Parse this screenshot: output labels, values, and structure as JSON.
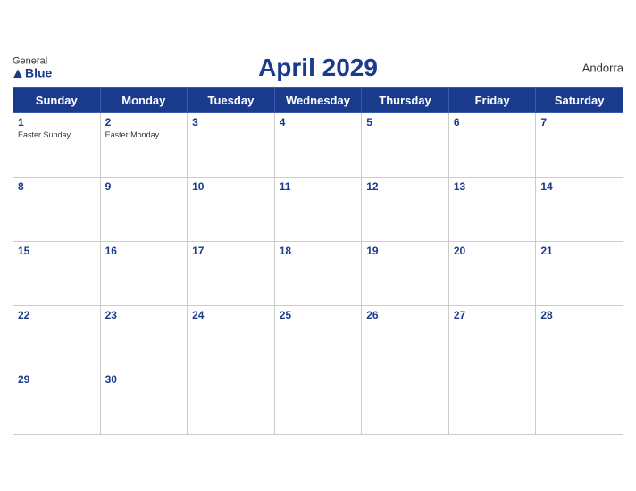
{
  "header": {
    "title": "April 2029",
    "region": "Andorra",
    "logo_general": "General",
    "logo_blue": "Blue"
  },
  "weekdays": [
    "Sunday",
    "Monday",
    "Tuesday",
    "Wednesday",
    "Thursday",
    "Friday",
    "Saturday"
  ],
  "weeks": [
    [
      {
        "day": "1",
        "holiday": "Easter Sunday"
      },
      {
        "day": "2",
        "holiday": "Easter Monday"
      },
      {
        "day": "3",
        "holiday": ""
      },
      {
        "day": "4",
        "holiday": ""
      },
      {
        "day": "5",
        "holiday": ""
      },
      {
        "day": "6",
        "holiday": ""
      },
      {
        "day": "7",
        "holiday": ""
      }
    ],
    [
      {
        "day": "8",
        "holiday": ""
      },
      {
        "day": "9",
        "holiday": ""
      },
      {
        "day": "10",
        "holiday": ""
      },
      {
        "day": "11",
        "holiday": ""
      },
      {
        "day": "12",
        "holiday": ""
      },
      {
        "day": "13",
        "holiday": ""
      },
      {
        "day": "14",
        "holiday": ""
      }
    ],
    [
      {
        "day": "15",
        "holiday": ""
      },
      {
        "day": "16",
        "holiday": ""
      },
      {
        "day": "17",
        "holiday": ""
      },
      {
        "day": "18",
        "holiday": ""
      },
      {
        "day": "19",
        "holiday": ""
      },
      {
        "day": "20",
        "holiday": ""
      },
      {
        "day": "21",
        "holiday": ""
      }
    ],
    [
      {
        "day": "22",
        "holiday": ""
      },
      {
        "day": "23",
        "holiday": ""
      },
      {
        "day": "24",
        "holiday": ""
      },
      {
        "day": "25",
        "holiday": ""
      },
      {
        "day": "26",
        "holiday": ""
      },
      {
        "day": "27",
        "holiday": ""
      },
      {
        "day": "28",
        "holiday": ""
      }
    ],
    [
      {
        "day": "29",
        "holiday": ""
      },
      {
        "day": "30",
        "holiday": ""
      },
      {
        "day": "",
        "holiday": ""
      },
      {
        "day": "",
        "holiday": ""
      },
      {
        "day": "",
        "holiday": ""
      },
      {
        "day": "",
        "holiday": ""
      },
      {
        "day": "",
        "holiday": ""
      }
    ]
  ]
}
